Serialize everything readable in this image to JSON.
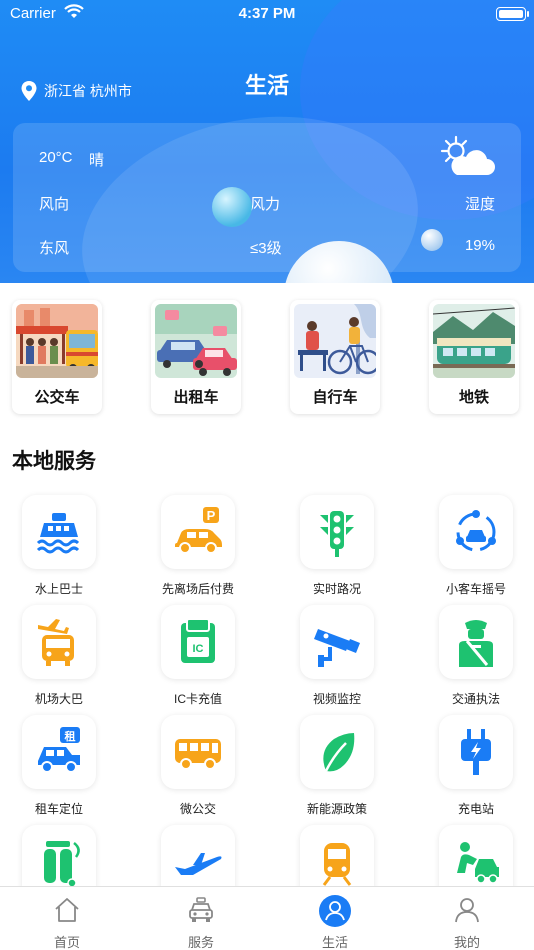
{
  "status_bar": {
    "carrier": "Carrier",
    "time": "4:37 PM"
  },
  "header": {
    "location": "浙江省 杭州市",
    "title": "生活"
  },
  "weather": {
    "temperature": "20°C",
    "condition": "晴",
    "labels": {
      "wind_direction": "风向",
      "wind_force": "风力",
      "humidity": "湿度"
    },
    "values": {
      "wind_direction": "东风",
      "wind_force": "≤3级",
      "humidity": "19%"
    },
    "icon": "partly-cloudy-icon"
  },
  "transport": [
    {
      "label": "公交车",
      "icon": "bus-illustration"
    },
    {
      "label": "出租车",
      "icon": "taxi-illustration"
    },
    {
      "label": "自行车",
      "icon": "bicycle-illustration"
    },
    {
      "label": "地铁",
      "icon": "subway-illustration"
    }
  ],
  "section_title": "本地服务",
  "services": [
    {
      "label": "水上巴士",
      "icon": "ferry-icon"
    },
    {
      "label": "先离场后付费",
      "icon": "parking-car-icon"
    },
    {
      "label": "实时路况",
      "icon": "traffic-light-icon"
    },
    {
      "label": "小客车摇号",
      "icon": "car-lottery-icon"
    },
    {
      "label": "机场大巴",
      "icon": "airport-bus-icon"
    },
    {
      "label": "IC卡充值",
      "icon": "ic-card-icon"
    },
    {
      "label": "视频监控",
      "icon": "surveillance-camera-icon"
    },
    {
      "label": "交通执法",
      "icon": "traffic-police-icon"
    },
    {
      "label": "租车定位",
      "icon": "rental-car-icon"
    },
    {
      "label": "微公交",
      "icon": "mini-bus-icon"
    },
    {
      "label": "新能源政策",
      "icon": "leaf-icon"
    },
    {
      "label": "充电站",
      "icon": "charging-plug-icon"
    },
    {
      "label": "",
      "icon": "gas-cylinder-icon"
    },
    {
      "label": "",
      "icon": "airplane-icon"
    },
    {
      "label": "",
      "icon": "train-icon"
    },
    {
      "label": "",
      "icon": "car-repair-icon"
    }
  ],
  "tabs": [
    {
      "label": "首页",
      "icon": "home-icon"
    },
    {
      "label": "服务",
      "icon": "taxi-icon"
    },
    {
      "label": "生活",
      "icon": "person-icon",
      "active": true
    },
    {
      "label": "我的",
      "icon": "user-icon"
    }
  ],
  "colors": {
    "header_blue": "#1f8cf5",
    "accent_blue": "#1a7cf5",
    "orange": "#f7a41a",
    "green": "#1ec270"
  }
}
